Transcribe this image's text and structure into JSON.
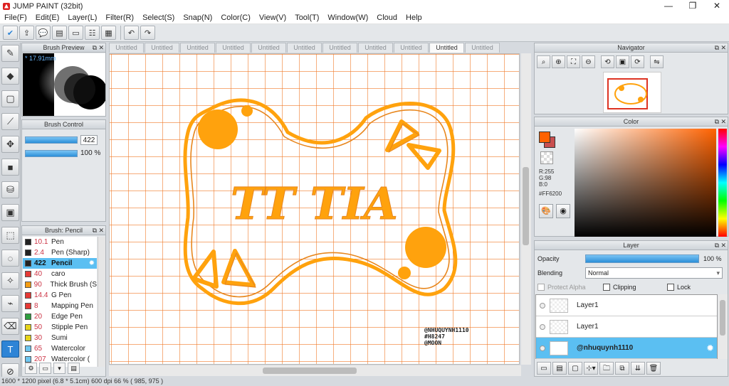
{
  "window": {
    "title": "JUMP PAINT (32bit)",
    "minimize": "—",
    "maximize": "❐",
    "close": "✕"
  },
  "menu": [
    "File(F)",
    "Edit(E)",
    "Layer(L)",
    "Filter(R)",
    "Select(S)",
    "Snap(N)",
    "Color(C)",
    "View(V)",
    "Tool(T)",
    "Window(W)",
    "Cloud",
    "Help"
  ],
  "brush_preview": {
    "title": "Brush Preview",
    "size_label": "* 17.91mm"
  },
  "brush_control": {
    "title": "Brush Control",
    "size_value": "422",
    "opacity_value": "100 %"
  },
  "brush_list": {
    "title": "Brush: Pencil",
    "items": [
      {
        "size": "10.1",
        "name": "Pen",
        "color": "#222222"
      },
      {
        "size": "2.4",
        "name": "Pen (Sharp)",
        "color": "#222222"
      },
      {
        "size": "422",
        "name": "Pencil",
        "color": "#222222",
        "selected": true
      },
      {
        "size": "40",
        "name": "caro",
        "color": "#e53935"
      },
      {
        "size": "90",
        "name": "Thick Brush (S",
        "color": "#f39c12"
      },
      {
        "size": "14.4",
        "name": "G Pen",
        "color": "#e53935"
      },
      {
        "size": "8",
        "name": "Mapping Pen",
        "color": "#e53935"
      },
      {
        "size": "20",
        "name": "Edge Pen",
        "color": "#2e9e3e"
      },
      {
        "size": "50",
        "name": "Stipple Pen",
        "color": "#e6d41a"
      },
      {
        "size": "30",
        "name": "Sumi",
        "color": "#e6d41a"
      },
      {
        "size": "65",
        "name": "Watercolor",
        "color": "#6ec6f0"
      },
      {
        "size": "207",
        "name": "Watercolor (",
        "color": "#6ec6f0"
      }
    ]
  },
  "tabs": [
    "Untitled",
    "Untitled",
    "Untitled",
    "Untitled",
    "Untitled",
    "Untitled",
    "Untitled",
    "Untitled",
    "Untitled",
    "Untitled",
    "Untitled"
  ],
  "active_tab_index": 9,
  "canvas": {
    "lettering": "TT TIA",
    "watermark": [
      "@NHUQUYNH1110",
      "#H8247",
      "@MOON"
    ],
    "accent": "#FFA20D",
    "grid_color": "#F07A2A"
  },
  "navigator": {
    "title": "Navigator"
  },
  "color": {
    "title": "Color",
    "rgb": [
      "R:255",
      "G:98",
      "B:0"
    ],
    "hex": "#FF6200",
    "foreground": "#FF6200",
    "background": "#C94F4F"
  },
  "layer_panel": {
    "title": "Layer",
    "opacity_label": "Opacity",
    "opacity_value": "100 %",
    "blending_label": "Blending",
    "blending_value": "Normal",
    "protect_alpha": "Protect Alpha",
    "clipping": "Clipping",
    "lock": "Lock",
    "layers": [
      {
        "name": "Layer1",
        "selected": false
      },
      {
        "name": "Layer1",
        "selected": false
      },
      {
        "name": "@nhuquynh1110",
        "selected": true
      }
    ]
  },
  "status": {
    "text": "1600 * 1200 pixel   (6.8 * 5.1cm)  600 dpi   66 %   ( 985, 975 )"
  }
}
